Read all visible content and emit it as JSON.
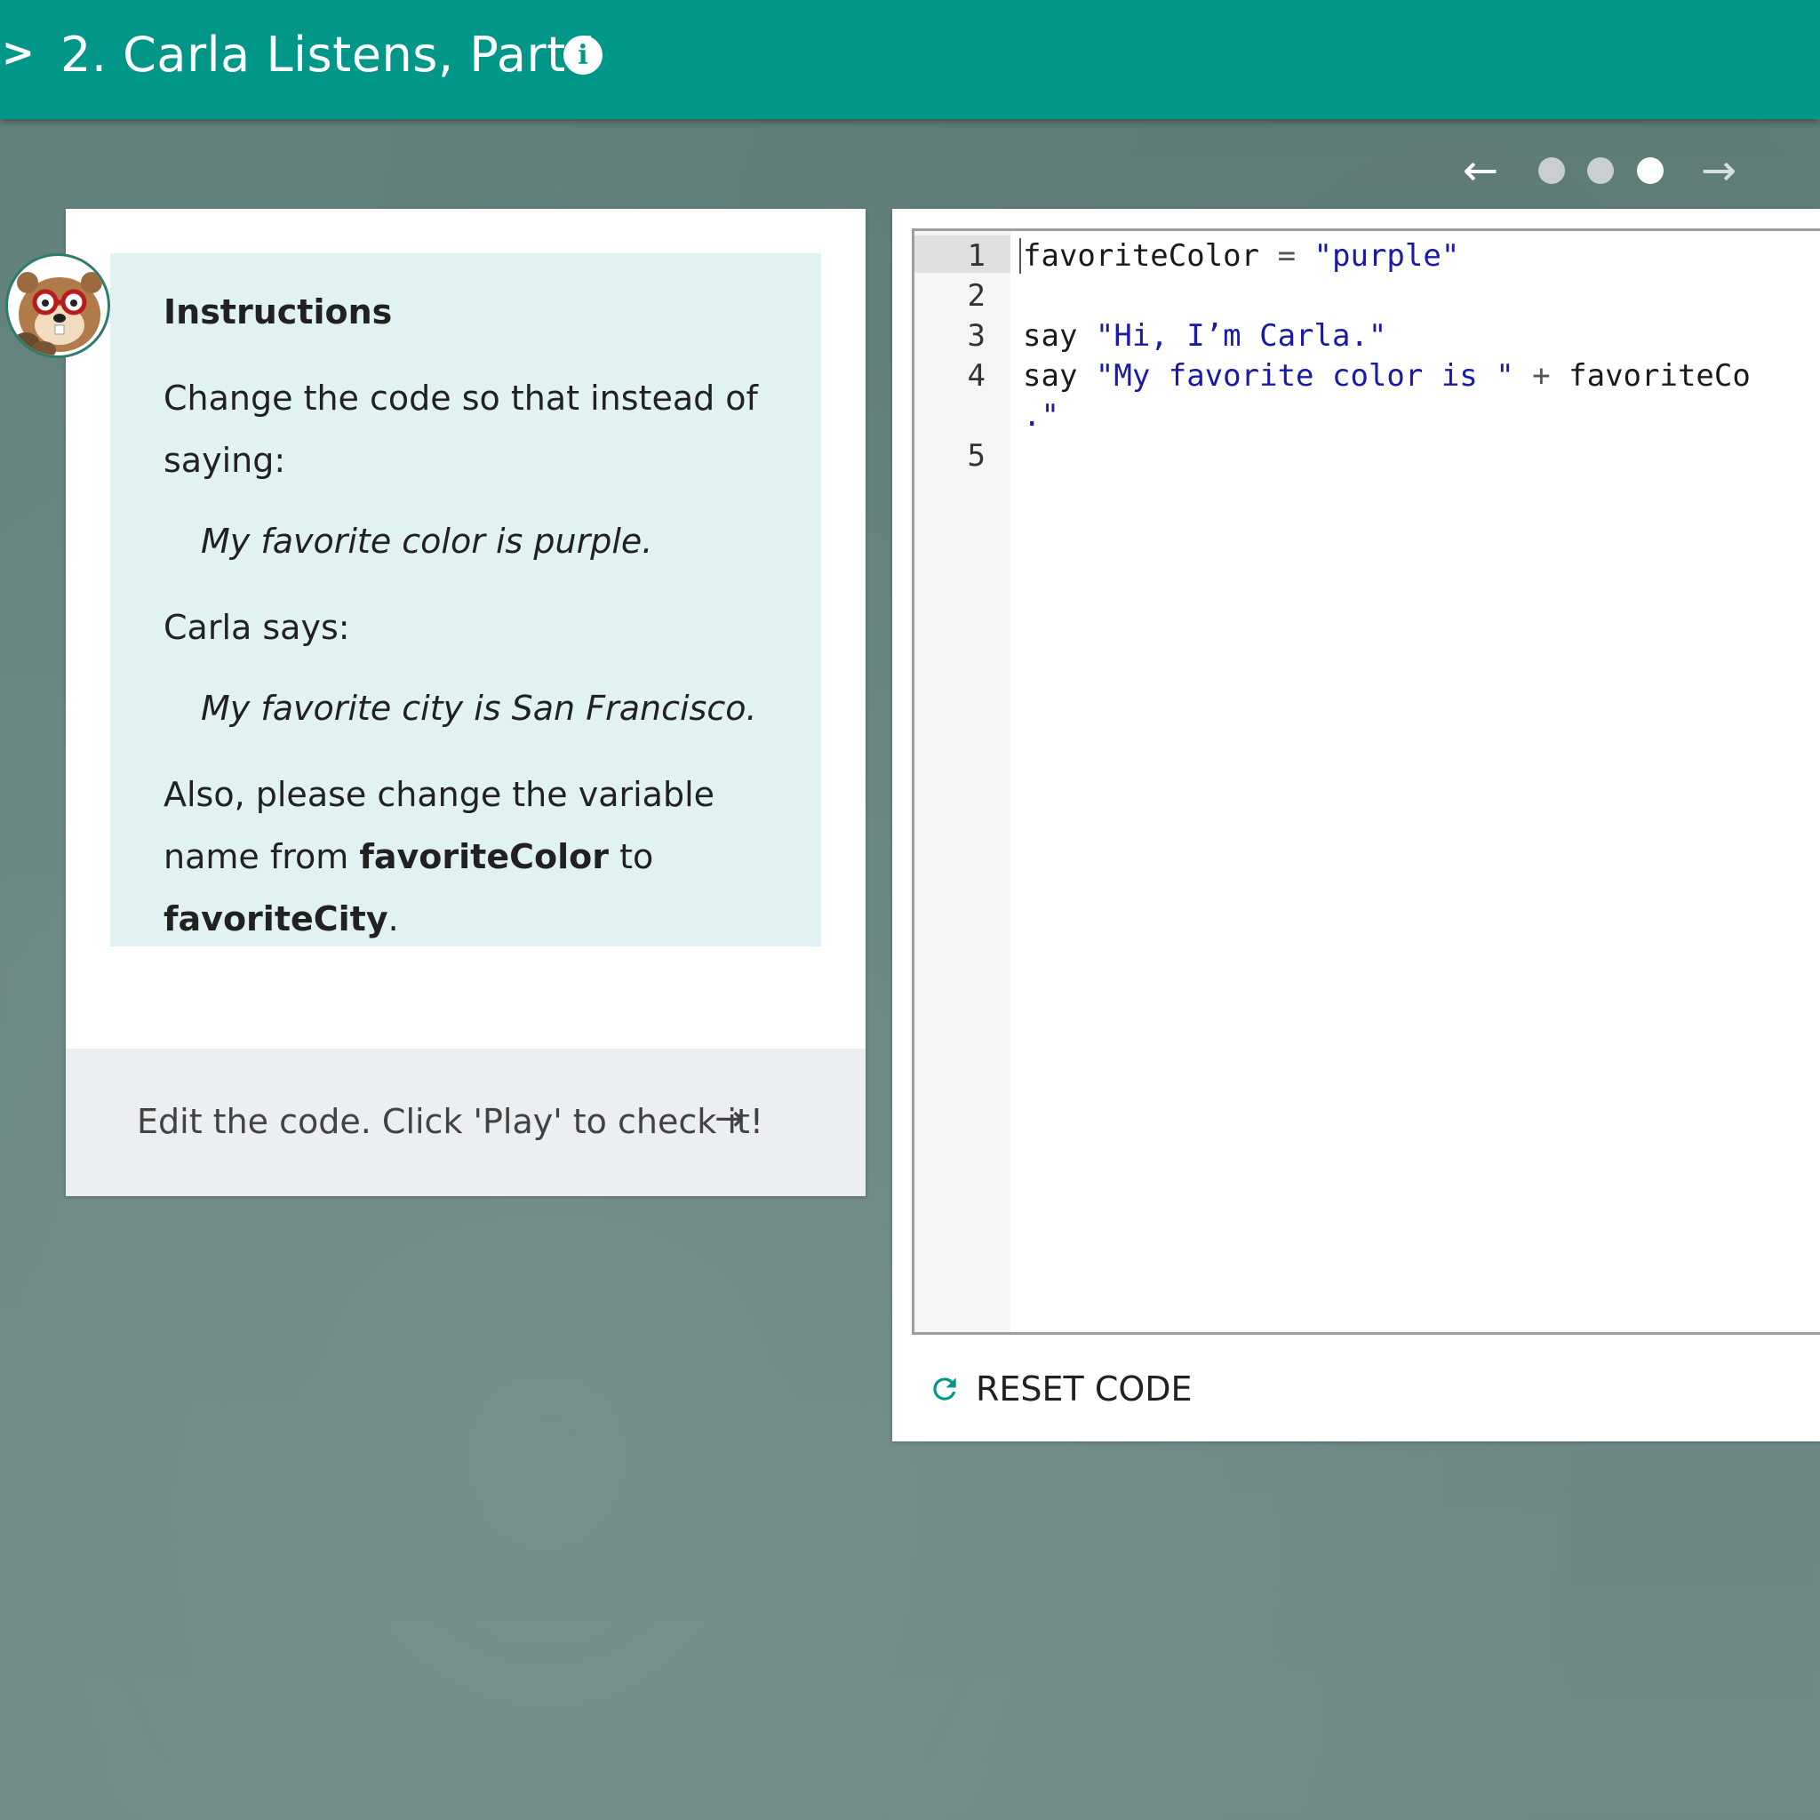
{
  "header": {
    "chevron": ">",
    "title": "2. Carla Listens, Part I",
    "info_icon": "i"
  },
  "step_nav": {
    "prev_icon": "arrow-left-icon",
    "next_icon": "arrow-right-icon",
    "prev_glyph": "←",
    "next_glyph": "→",
    "total_steps": 3,
    "current_step": 3
  },
  "instructions": {
    "heading": "Instructions",
    "p1": "Change the code so that instead of saying:",
    "quote1": "My favorite color is purple.",
    "p2": "Carla says:",
    "quote2": "My favorite city is San Francisco.",
    "p3_a": "Also, please change the variable name from ",
    "p3_b": "favoriteColor",
    "p3_c": " to ",
    "p3_d": "favoriteCity",
    "p3_e": ".",
    "hint": "Edit the code. Click 'Play' to check it!",
    "hint_arrow": "→"
  },
  "editor": {
    "line_numbers": [
      "1",
      "2",
      "3",
      "4",
      "",
      "5"
    ],
    "lines": {
      "l1_a": "favoriteColor ",
      "l1_b": "=",
      "l1_c": " ",
      "l1_d": "\"purple\"",
      "l3_a": "say ",
      "l3_b": "\"Hi, I’m Carla.\"",
      "l4_a": "say ",
      "l4_b": "\"My favorite color is \"",
      "l4_c": " + ",
      "l4_d": "favoriteCo",
      "l4w": ".\""
    },
    "reset_label": "RESET CODE"
  },
  "colors": {
    "header_bg": "#009688",
    "instructions_bg": "#e0f2f1",
    "string_color": "#1a1aa6"
  }
}
